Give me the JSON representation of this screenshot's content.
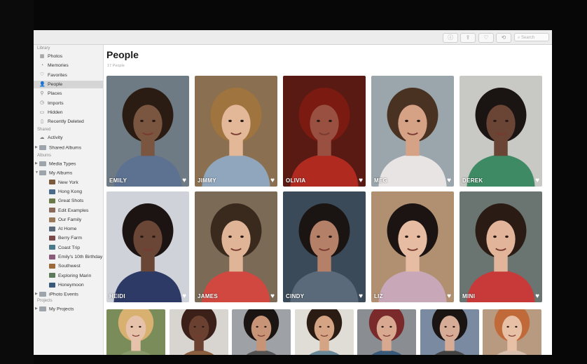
{
  "toolbar": {
    "buttons": [
      "info-icon",
      "share-icon",
      "favorite-icon",
      "rotate-icon"
    ],
    "search_placeholder": "Search"
  },
  "sidebar": {
    "library_header": "Library",
    "library": [
      {
        "label": "Photos",
        "icon": "photos-icon"
      },
      {
        "label": "Memories",
        "icon": "memories-icon"
      },
      {
        "label": "Favorites",
        "icon": "heart-icon"
      },
      {
        "label": "People",
        "icon": "person-icon",
        "selected": true
      },
      {
        "label": "Places",
        "icon": "pin-icon"
      },
      {
        "label": "Imports",
        "icon": "clock-icon"
      },
      {
        "label": "Hidden",
        "icon": "hidden-icon"
      },
      {
        "label": "Recently Deleted",
        "icon": "trash-icon"
      }
    ],
    "shared_header": "Shared",
    "shared": [
      {
        "label": "Activity",
        "icon": "cloud-icon"
      },
      {
        "label": "Shared Albums",
        "icon": "folder-icon"
      }
    ],
    "albums_header": "Albums",
    "albums": [
      {
        "label": "Media Types",
        "icon": "folder-icon"
      },
      {
        "label": "My Albums",
        "icon": "folder-icon"
      },
      {
        "label": "New York",
        "color": "#7a5a3a"
      },
      {
        "label": "Hong Kong",
        "color": "#4a6a8a"
      },
      {
        "label": "Great Shots",
        "color": "#6a7a4a"
      },
      {
        "label": "Edit Examples",
        "color": "#8a6a5a"
      },
      {
        "label": "Our Family",
        "color": "#9a7a5a"
      },
      {
        "label": "At Home",
        "color": "#5a6a7a"
      },
      {
        "label": "Berry Farm",
        "color": "#7a4a4a"
      },
      {
        "label": "Coast Trip",
        "color": "#4a7a8a"
      },
      {
        "label": "Emily's 10th Birthday",
        "color": "#8a5a7a"
      },
      {
        "label": "Southwest",
        "color": "#9a6a3a"
      },
      {
        "label": "Exploring Marin",
        "color": "#5a7a5a"
      },
      {
        "label": "Honeymoon",
        "color": "#3a5a7a"
      },
      {
        "label": "iPhoto Events",
        "icon": "folder-icon"
      }
    ],
    "projects_header": "Projects",
    "projects": [
      {
        "label": "My Projects",
        "icon": "folder-icon"
      }
    ]
  },
  "main": {
    "title": "People",
    "count": "17 People"
  },
  "people": [
    {
      "name": "EMILY",
      "bg": "#6f7b84",
      "skin": "#7a5640",
      "hair": "#2a1c12",
      "shirt": "#5d7290"
    },
    {
      "name": "JIMMY",
      "bg": "#8a7050",
      "skin": "#e2b898",
      "hair": "#a0743e",
      "shirt": "#8fa6bd"
    },
    {
      "name": "OLIVIA",
      "bg": "#5a1a14",
      "skin": "#9a5040",
      "hair": "#7a1a10",
      "shirt": "#b02a20"
    },
    {
      "name": "MEG",
      "bg": "#9aa6ac",
      "skin": "#d6a286",
      "hair": "#4a3222",
      "shirt": "#e8e4e4"
    },
    {
      "name": "DEREK",
      "bg": "#c8c8c4",
      "skin": "#6a4434",
      "hair": "#1a1412",
      "shirt": "#3e8a64"
    },
    {
      "name": "HEIDI",
      "bg": "#cfd2d8",
      "skin": "#6a4636",
      "hair": "#1c1412",
      "shirt": "#2e3a66"
    },
    {
      "name": "JAMES",
      "bg": "#7a6a56",
      "skin": "#e0b496",
      "hair": "#3a2a1e",
      "shirt": "#d04840"
    },
    {
      "name": "CINDY",
      "bg": "#3a4a58",
      "skin": "#b48068",
      "hair": "#1a1412",
      "shirt": "#5a6a7a"
    },
    {
      "name": "LIZ",
      "bg": "#b09070",
      "skin": "#e6bca2",
      "hair": "#1c1412",
      "shirt": "#c8a8b8"
    },
    {
      "name": "MINI",
      "bg": "#6a7470",
      "skin": "#e2b49a",
      "hair": "#2a1c14",
      "shirt": "#c83a3a"
    },
    {
      "name": "",
      "bg": "#7a8c5a",
      "skin": "#e6c2aa",
      "hair": "#d8b070",
      "shirt": "#8a9a6a"
    },
    {
      "name": "",
      "bg": "#d8d4d0",
      "skin": "#6a4030",
      "hair": "#3a2018",
      "shirt": "#8a6040"
    },
    {
      "name": "",
      "bg": "#9ea2a6",
      "skin": "#c89478",
      "hair": "#1a1412",
      "shirt": "#555"
    },
    {
      "name": "",
      "bg": "#e0dcd6",
      "skin": "#d4a484",
      "hair": "#2a1c12",
      "shirt": "#6a8a9a"
    },
    {
      "name": "",
      "bg": "#8a8e92",
      "skin": "#d8a890",
      "hair": "#7a2a2a",
      "shirt": "#3a5a7a"
    },
    {
      "name": "",
      "bg": "#7a8aa0",
      "skin": "#d6ac96",
      "hair": "#1a1412",
      "shirt": "#444"
    },
    {
      "name": "",
      "bg": "#b89a80",
      "skin": "#e8c0a6",
      "hair": "#c06a3a",
      "shirt": "#d8c0b0"
    }
  ]
}
